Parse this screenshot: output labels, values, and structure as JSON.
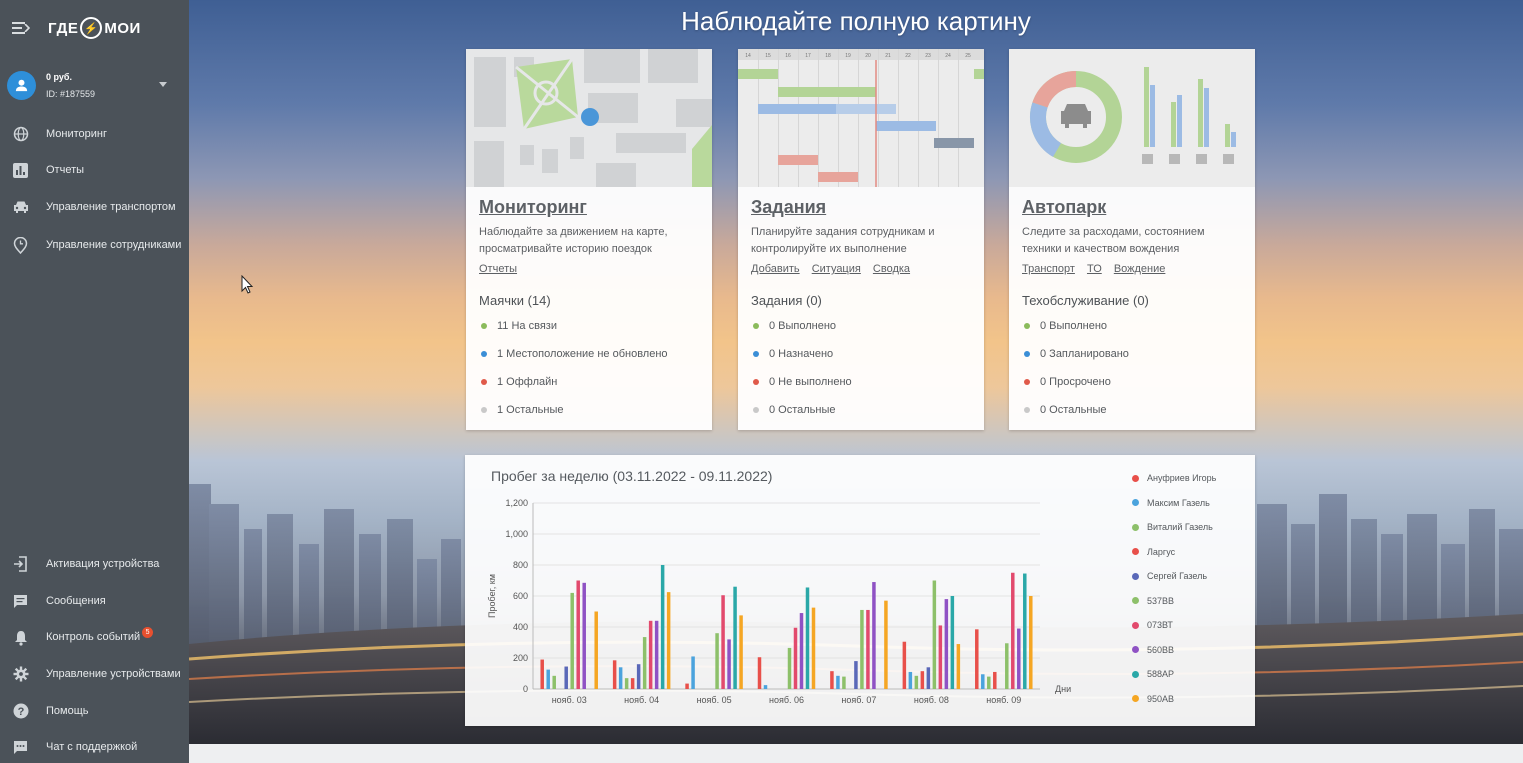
{
  "app": {
    "logo_left": "ГДЕ",
    "logo_right": "МОИ"
  },
  "user": {
    "balance": "0 руб.",
    "id": "ID: #187559"
  },
  "sidebar": {
    "items": [
      {
        "label": "Мониторинг",
        "icon": "globe-icon"
      },
      {
        "label": "Отчеты",
        "icon": "bar-chart-icon"
      },
      {
        "label": "Управление транспортом",
        "icon": "car-icon"
      },
      {
        "label": "Управление сотрудниками",
        "icon": "location-clock-icon"
      }
    ],
    "bottom_items": [
      {
        "label": "Активация устройства",
        "icon": "login-icon"
      },
      {
        "label": "Сообщения",
        "icon": "message-icon"
      },
      {
        "label": "Контроль событий",
        "icon": "bell-icon",
        "badge": "5"
      },
      {
        "label": "Управление устройствами",
        "icon": "gear-icon"
      },
      {
        "label": "Помощь",
        "icon": "help-icon"
      },
      {
        "label": "Чат с поддержкой",
        "icon": "chat-icon"
      }
    ]
  },
  "main": {
    "title": "Наблюдайте полную картину"
  },
  "cards": [
    {
      "title": "Мониторинг",
      "desc": "Наблюдайте за движением на карте, просматривайте историю поездок",
      "links": [
        "Отчеты"
      ],
      "sub": "Маячки (14)",
      "stats": [
        {
          "text": "11 На связи",
          "color": "#8bbb5c"
        },
        {
          "text": "1 Местоположение не обновлено",
          "color": "#3b8ed6"
        },
        {
          "text": "1 Оффлайн",
          "color": "#e05a4a"
        },
        {
          "text": "1 Остальные",
          "color": "#c9c9c9"
        }
      ]
    },
    {
      "title": "Задания",
      "desc": "Планируйте задания сотрудникам и контролируйте их выполнение",
      "links": [
        "Добавить",
        "Ситуация",
        "Сводка"
      ],
      "sub": "Задания (0)",
      "stats": [
        {
          "text": "0 Выполнено",
          "color": "#8bbb5c"
        },
        {
          "text": "0 Назначено",
          "color": "#3b8ed6"
        },
        {
          "text": "0 Не выполнено",
          "color": "#e05a4a"
        },
        {
          "text": "0 Остальные",
          "color": "#c9c9c9"
        }
      ],
      "gantt_days": [
        "14",
        "15",
        "16",
        "17",
        "18",
        "19",
        "20",
        "21",
        "22",
        "23",
        "24",
        "25"
      ]
    },
    {
      "title": "Автопарк",
      "desc": "Следите за расходами, состоянием техники и качеством вождения",
      "links": [
        "Транспорт",
        "ТО",
        "Вождение"
      ],
      "sub": "Техобслуживание (0)",
      "stats": [
        {
          "text": "0 Выполнено",
          "color": "#8bbb5c"
        },
        {
          "text": "0 Запланировано",
          "color": "#3b8ed6"
        },
        {
          "text": "0 Просрочено",
          "color": "#e05a4a"
        },
        {
          "text": "0 Остальные",
          "color": "#c9c9c9"
        }
      ]
    }
  ],
  "chart_data": {
    "type": "bar",
    "title": "Пробег за неделю (03.11.2022 - 09.11.2022)",
    "xlabel": "Дни",
    "ylabel": "Пробег, км",
    "ylim": [
      0,
      1200
    ],
    "yticks": [
      "0",
      "200",
      "400",
      "600",
      "800",
      "1,000",
      "1,200"
    ],
    "grid": true,
    "legend_position": "right",
    "categories": [
      "нояб. 03",
      "нояб. 04",
      "нояб. 05",
      "нояб. 06",
      "нояб. 07",
      "нояб. 08",
      "нояб. 09"
    ],
    "series": [
      {
        "name": "Ануфриев Игорь",
        "color": "#e8504a",
        "values": [
          190,
          185,
          35,
          205,
          115,
          305,
          385
        ]
      },
      {
        "name": "Максим Газель",
        "color": "#4ba3dd",
        "values": [
          125,
          140,
          210,
          25,
          85,
          110,
          95
        ]
      },
      {
        "name": "Виталий Газель",
        "color": "#8dc06a",
        "values": [
          85,
          70,
          0,
          0,
          80,
          85,
          80
        ]
      },
      {
        "name": "Ларгус",
        "color": "#e8504a",
        "values": [
          0,
          70,
          0,
          0,
          0,
          115,
          110
        ]
      },
      {
        "name": "Сергей Газель",
        "color": "#5a68b8",
        "values": [
          145,
          160,
          0,
          0,
          180,
          140,
          0
        ]
      },
      {
        "name": "537ВВ",
        "color": "#8dc06a",
        "values": [
          620,
          335,
          360,
          265,
          510,
          700,
          295
        ]
      },
      {
        "name": "073ВТ",
        "color": "#e24a6d",
        "values": [
          700,
          440,
          605,
          395,
          510,
          410,
          750
        ]
      },
      {
        "name": "560ВВ",
        "color": "#8f52c4",
        "values": [
          685,
          440,
          320,
          490,
          690,
          580,
          390
        ]
      },
      {
        "name": "588АР",
        "color": "#2aa8a8",
        "values": [
          0,
          800,
          660,
          655,
          0,
          600,
          745
        ]
      },
      {
        "name": "950АВ",
        "color": "#f5a623",
        "values": [
          500,
          625,
          475,
          525,
          570,
          290,
          600
        ]
      }
    ]
  }
}
